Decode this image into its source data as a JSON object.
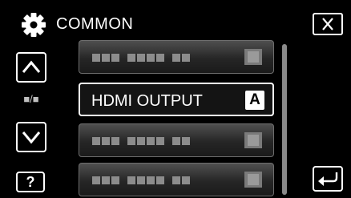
{
  "header": {
    "title": "COMMON",
    "icon": "gear-icon"
  },
  "side": {
    "page_indicator": "■/■",
    "help_label": "?"
  },
  "menu": {
    "items": [
      {
        "label": "",
        "placeholder": true
      },
      {
        "label": "HDMI OUTPUT",
        "badge": "A",
        "placeholder": false,
        "selected": true
      },
      {
        "label": "",
        "placeholder": true
      },
      {
        "label": "",
        "placeholder": true
      }
    ]
  },
  "colors": {
    "background": "#000000",
    "text": "#ffffff",
    "row_gradient_top": "#4f4f4f",
    "row_gradient_bottom": "#1a1a1a"
  }
}
